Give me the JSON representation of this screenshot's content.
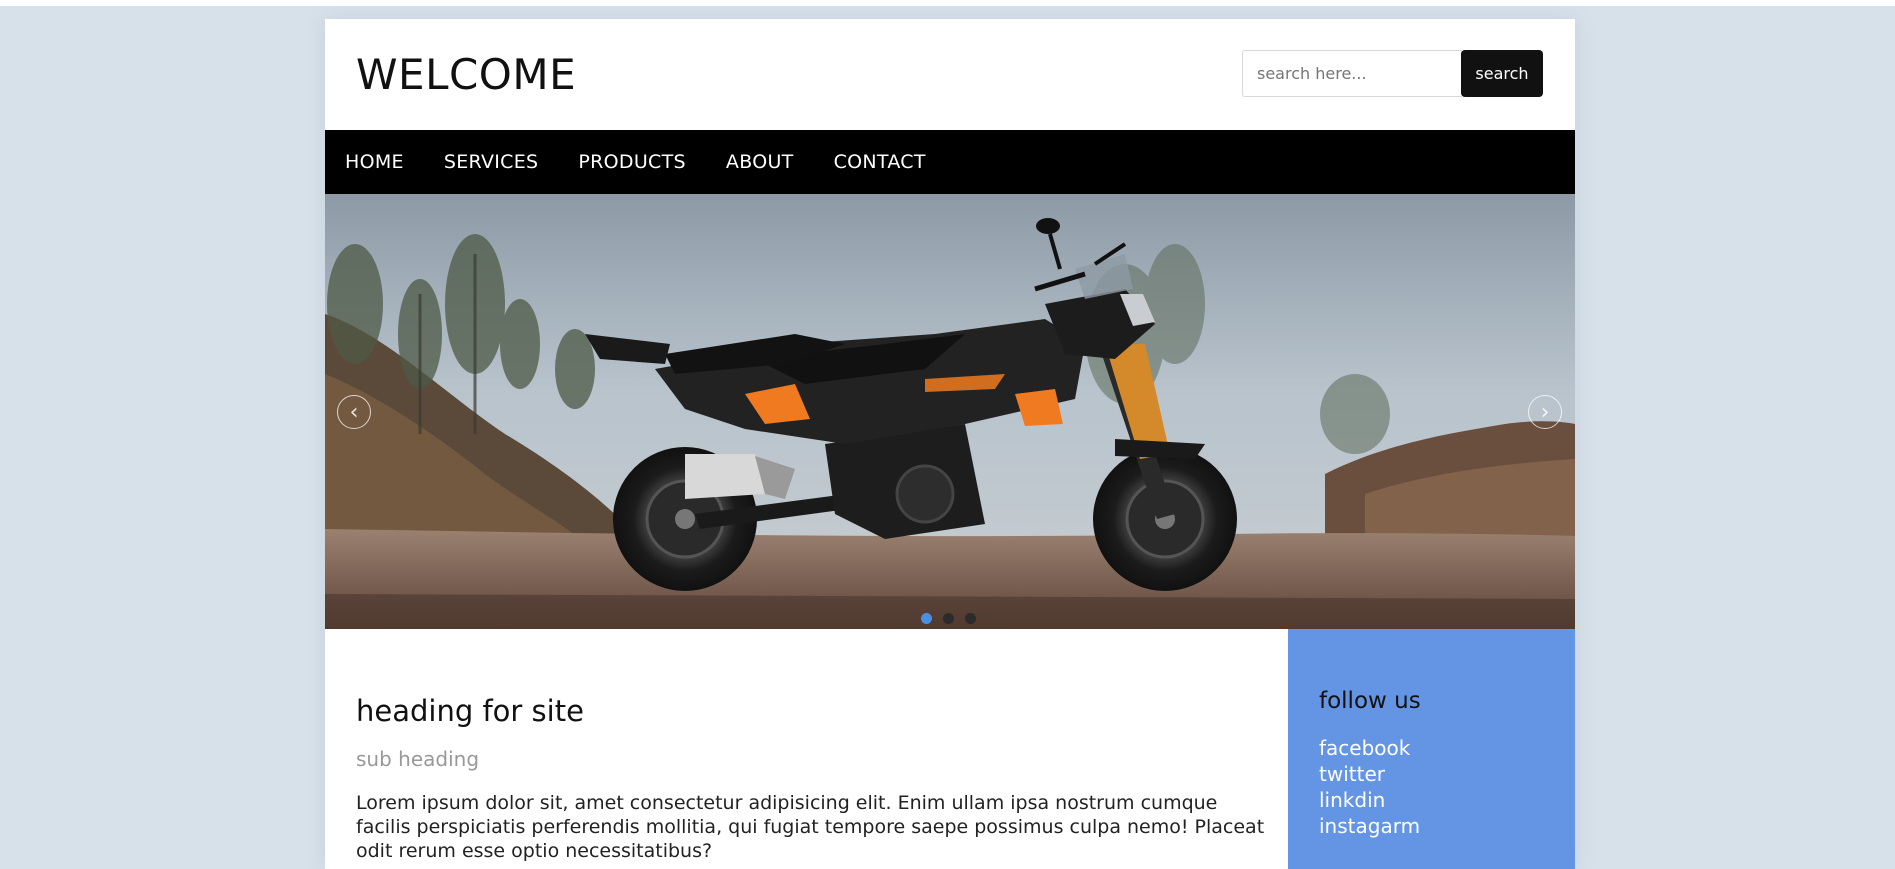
{
  "header": {
    "title": "WELCOME",
    "search_placeholder": "search here...",
    "search_button": "search"
  },
  "nav": {
    "items": [
      "HOME",
      "SERVICES",
      "PRODUCTS",
      "ABOUT",
      "CONTACT"
    ]
  },
  "slider": {
    "prev_icon": "chevron-left-icon",
    "next_icon": "chevron-right-icon",
    "slide_count": 3,
    "active_slide": 1
  },
  "main": {
    "heading": "heading for site",
    "subheading": "sub heading",
    "body": "Lorem ipsum dolor sit, amet consectetur adipisicing elit. Enim ullam ipsa nostrum cumque facilis perspiciatis perferendis mollitia, qui fugiat tempore saepe possimus culpa nemo! Placeat odit rerum esse optio necessitatibus?"
  },
  "sidebar": {
    "heading": "follow us",
    "links": [
      "facebook",
      "twitter",
      "linkdin",
      "instagarm"
    ]
  },
  "colors": {
    "page_bg": "#d7e1ea",
    "nav_bg": "#000000",
    "sidebar_bg": "#6395e4",
    "active_dot": "#4a90e2"
  }
}
